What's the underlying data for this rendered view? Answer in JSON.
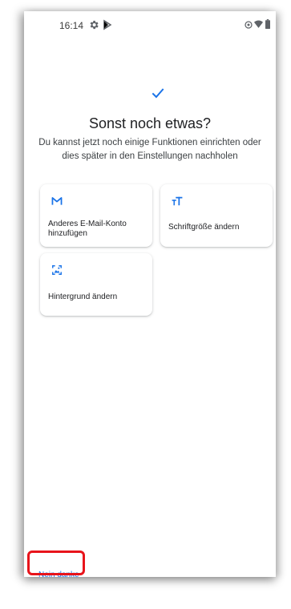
{
  "status_bar": {
    "time": "16:14",
    "icons": [
      "gear-icon",
      "play-store-icon",
      "eye-icon",
      "wifi-icon",
      "battery-icon"
    ]
  },
  "header": {
    "title": "Sonst noch etwas?",
    "subtitle": "Du kannst jetzt noch einige Funktionen einrichten oder dies später in den Einstellungen nachholen"
  },
  "options": [
    {
      "label": "Anderes E-Mail-Konto hinzufügen",
      "icon": "gmail-icon"
    },
    {
      "label": "Schriftgröße ändern",
      "icon": "font-size-icon"
    },
    {
      "label": "Hintergrund ändern",
      "icon": "wallpaper-icon"
    }
  ],
  "footer": {
    "no_thanks_label": "Nein danke"
  },
  "colors": {
    "accent": "#1a73e8",
    "highlight": "#e8141b",
    "text_primary": "#202124"
  }
}
